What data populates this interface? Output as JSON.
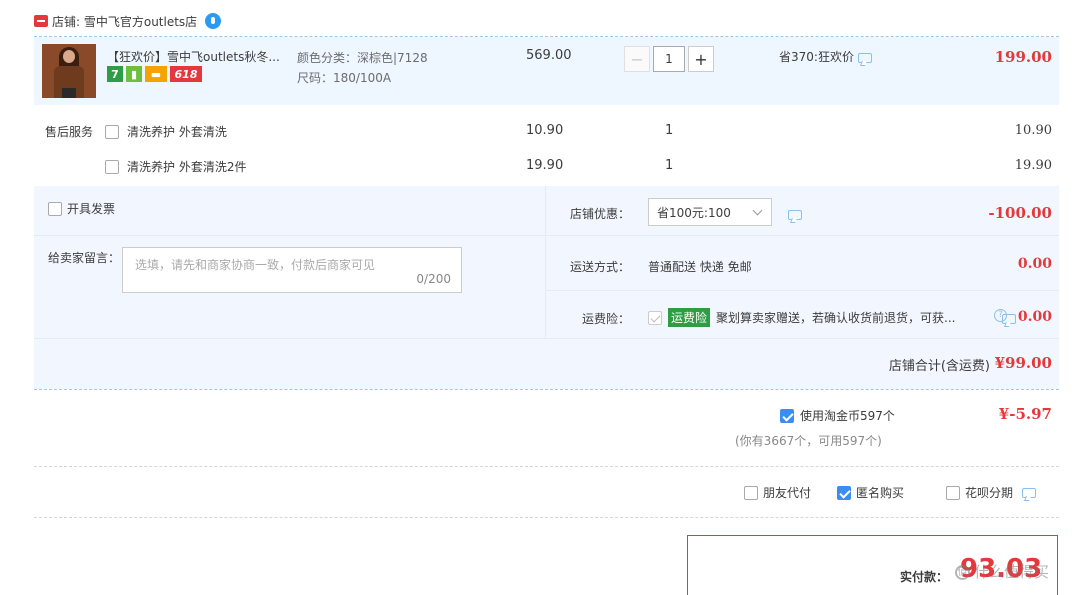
{
  "shop": {
    "name": "店铺: 雪中飞官方outlets店"
  },
  "item": {
    "title": "【狂欢价】雪中飞outlets秋冬...",
    "tags": [
      "7",
      "618"
    ],
    "spec_color": "颜色分类：深棕色|7128",
    "spec_size": "尺码：180/100A",
    "price": "569.00",
    "qty": "1",
    "save_text": "省370:狂欢价",
    "amount": "199.00"
  },
  "services": {
    "label": "售后服务",
    "items": [
      {
        "name": "清洗养护 外套清洗",
        "price": "10.90",
        "qty": "1",
        "amount": "10.90"
      },
      {
        "name": "清洗养护 外套清洗2件",
        "price": "19.90",
        "qty": "1",
        "amount": "19.90"
      }
    ]
  },
  "invoice": {
    "label": "开具发票"
  },
  "message": {
    "label": "给卖家留言：",
    "placeholder": "选填，请先和商家协商一致，付款后商家可见",
    "count": "0/200"
  },
  "coupon": {
    "label": "店铺优惠：",
    "value": "省100元:100",
    "amount": "-100.00"
  },
  "shipping": {
    "label": "运送方式：",
    "value": "普通配送 快递 免邮",
    "amount": "0.00"
  },
  "insurance": {
    "label": "运费险：",
    "badge": "运费险",
    "text": "聚划算卖家赠送，若确认收货前退货，可获...",
    "amount": "0.00"
  },
  "total": {
    "label": "店铺合计(含运费)",
    "amount": "¥99.00"
  },
  "coins": {
    "label": "使用淘金币597个",
    "sub": "(你有3667个，可用597个)",
    "amount": "¥-5.97"
  },
  "pay_options": [
    {
      "label": "朋友代付",
      "checked": false
    },
    {
      "label": "匿名购买",
      "checked": true
    },
    {
      "label": "花呗分期",
      "checked": false
    }
  ],
  "final": {
    "label": "实付款：",
    "amount": "93.03"
  },
  "watermark": "值 什么值得买",
  "colors": {
    "accent_red": "#e4393c",
    "light_blue_bg": "#eef6ff",
    "check_blue": "#3c8df0",
    "green_badge": "#2e9e44"
  }
}
